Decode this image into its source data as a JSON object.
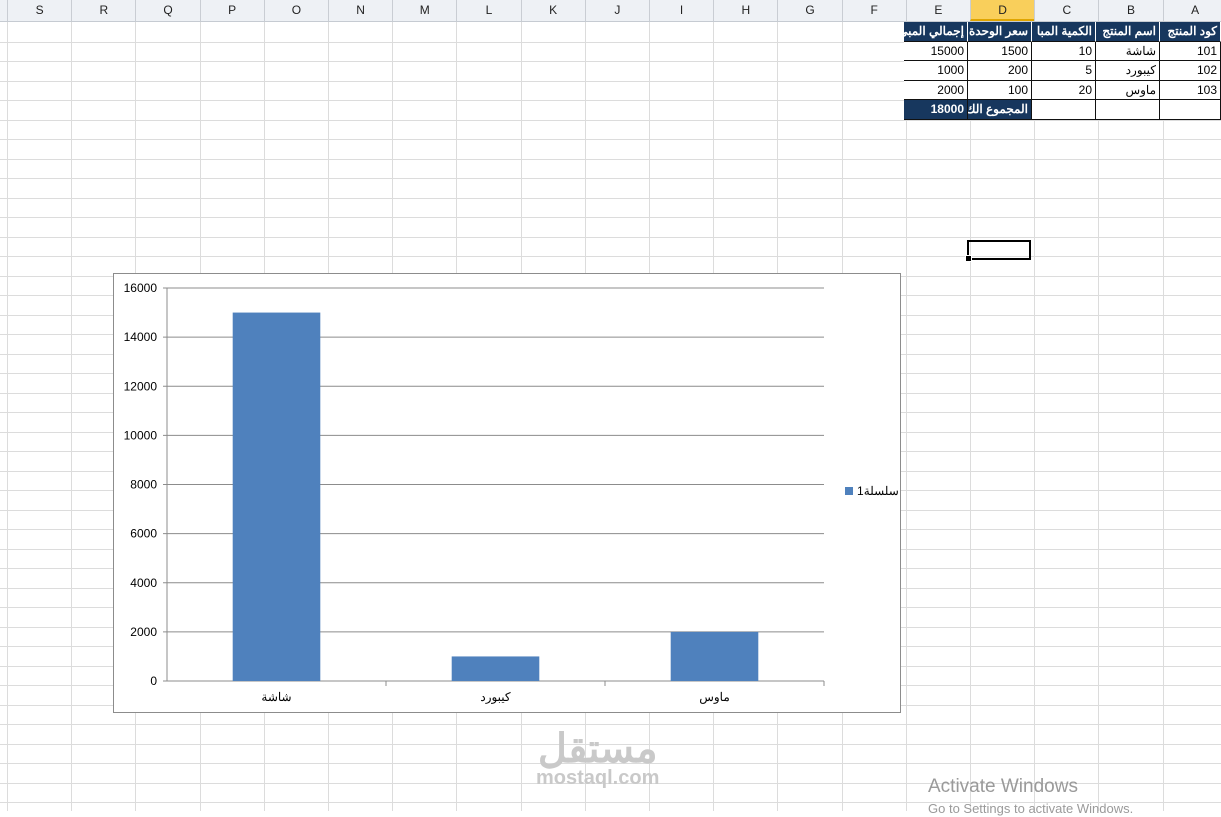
{
  "columns": [
    "S",
    "R",
    "Q",
    "P",
    "O",
    "N",
    "M",
    "L",
    "K",
    "J",
    "I",
    "H",
    "G",
    "F",
    "E",
    "D",
    "C",
    "B",
    "A"
  ],
  "selected_column": "D",
  "table": {
    "headers": [
      "كود المنتج",
      "اسم المنتج",
      "الكمية المبا",
      "سعر الوحدة",
      "إجمالي المبي"
    ],
    "rows": [
      [
        "101",
        "شاشة",
        "10",
        "1500",
        "15000"
      ],
      [
        "102",
        "كيبورد",
        "5",
        "200",
        "1000"
      ],
      [
        "103",
        "ماوس",
        "20",
        "100",
        "2000"
      ]
    ],
    "total_label": "المجموع الك",
    "total_value": "18000"
  },
  "chart_data": {
    "type": "bar",
    "categories": [
      "شاشة",
      "كيبورد",
      "ماوس"
    ],
    "series": [
      {
        "name": "سلسلة1",
        "values": [
          15000,
          1000,
          2000
        ]
      }
    ],
    "title": "",
    "xlabel": "",
    "ylabel": "",
    "ylim": [
      0,
      16000
    ],
    "yticks": [
      0,
      2000,
      4000,
      6000,
      8000,
      10000,
      12000,
      14000,
      16000
    ],
    "grid": true,
    "legend": "right",
    "bar_color": "#4f81bd"
  },
  "watermark": {
    "arabic": "مستقل",
    "latin": "mostaql.com"
  },
  "activation": {
    "title": "Activate Windows",
    "subtitle": "Go to Settings to activate Windows."
  }
}
